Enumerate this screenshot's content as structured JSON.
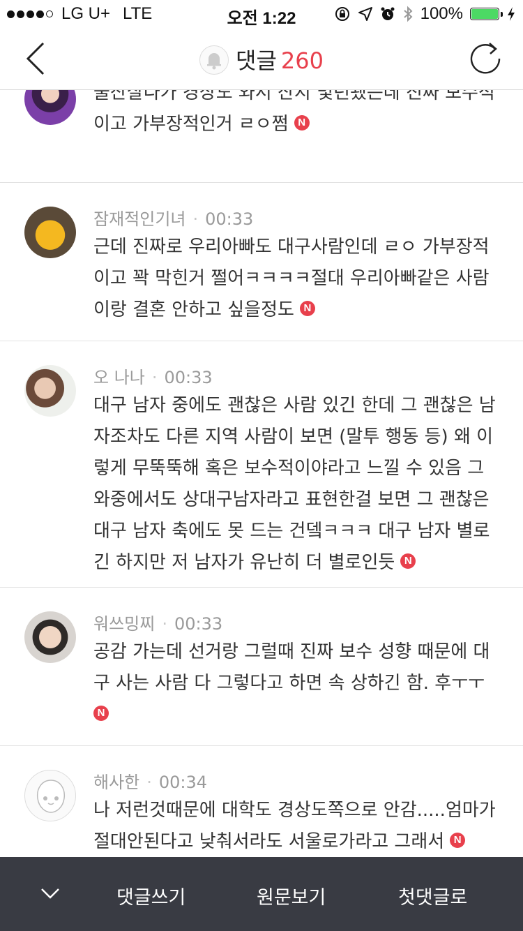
{
  "status": {
    "carrier": "LG U+",
    "network": "LTE",
    "time": "오전 1:22",
    "battery": "100%",
    "battery_level": 1.0
  },
  "nav": {
    "title": "댓글",
    "count": "260"
  },
  "comments": [
    {
      "author": "",
      "time": "",
      "lines": [
        "울산살다가 경상도 와서 산지 몇년됐는데 진짜 보수적",
        "이고 가부장적인거 ㄹㅇ쩜"
      ],
      "badge": "N"
    },
    {
      "author": "잠재적인기녀",
      "time": "00:33",
      "lines": [
        "근데 진짜로 우리아빠도 대구사람인데 ㄹㅇ 가부장적",
        "이고 꽉 막힌거 쩔어ㅋㅋㅋㅋ절대 우리아빠같은 사람",
        "이랑 결혼 안하고 싶을정도"
      ],
      "badge": "N"
    },
    {
      "author": "오 나나",
      "time": "00:33",
      "lines": [
        "대구 남자 중에도 괜찮은 사람 있긴 한데 그 괜찮은 남",
        "자조차도 다른 지역 사람이 보면 (말투 행동 등) 왜 이",
        "렇게 무뚝뚝해 혹은 보수적이야라고 느낄 수 있음 그",
        "와중에서도 상대구남자라고 표현한걸 보면 그 괜찮은",
        "대구 남자 축에도 못 드는 건뎈ㅋㅋㅋ 대구 남자 별로",
        "긴 하지만 저 남자가 유난히 더 별로인듯"
      ],
      "badge": "N"
    },
    {
      "author": "워쓰밍찌",
      "time": "00:33",
      "lines": [
        "공감 가는데 선거랑 그럴때 진짜 보수 성향 때문에 대",
        "구 사는 사람 다 그렇다고 하면 속 상하긴 함. 후ㅜㅜ",
        ""
      ],
      "badge": "N"
    },
    {
      "author": "해사한",
      "time": "00:34",
      "lines": [
        "나 저런것때문에 대학도 경상도쪽으로 안감.....엄마가",
        "절대안된다고 낮춰서라도 서울로가라고 그래서"
      ],
      "badge": "N"
    }
  ],
  "toolbar": {
    "write": "댓글쓰기",
    "original": "원문보기",
    "first": "첫댓글로"
  },
  "colors": {
    "accent": "#e8404c",
    "toolbar_bg": "#393b43",
    "battery": "#4cd964"
  }
}
